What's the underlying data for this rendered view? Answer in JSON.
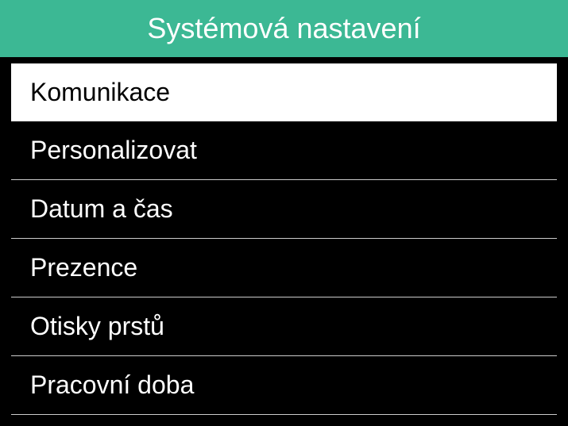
{
  "header": {
    "title": "Systémová nastavení"
  },
  "menu": {
    "items": [
      {
        "label": "Komunikace",
        "selected": true
      },
      {
        "label": "Personalizovat",
        "selected": false
      },
      {
        "label": "Datum a čas",
        "selected": false
      },
      {
        "label": "Prezence",
        "selected": false
      },
      {
        "label": "Otisky prstů",
        "selected": false
      },
      {
        "label": "Pracovní doba",
        "selected": false
      }
    ]
  }
}
